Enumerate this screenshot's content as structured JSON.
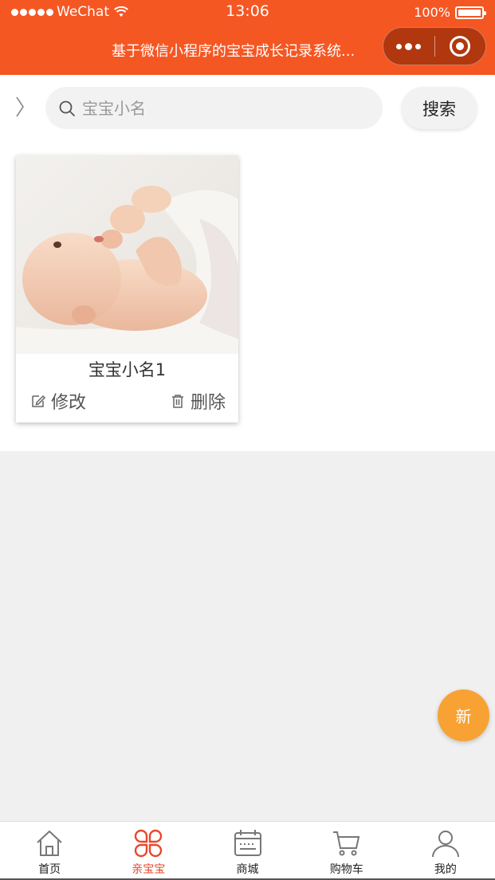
{
  "status_bar": {
    "carrier": "WeChat",
    "time": "13:06",
    "battery": "100%"
  },
  "nav": {
    "title": "基于微信小程序的宝宝成长记录系统..."
  },
  "search": {
    "placeholder": "宝宝小名",
    "button_label": "搜索"
  },
  "baby_cards": [
    {
      "name": "宝宝小名1",
      "edit_label": "修改",
      "delete_label": "删除"
    }
  ],
  "fab": {
    "label": "新"
  },
  "tabbar": {
    "items": [
      {
        "label": "首页",
        "icon": "home-icon",
        "active": false
      },
      {
        "label": "亲宝宝",
        "icon": "clover-icon",
        "active": true
      },
      {
        "label": "商城",
        "icon": "calendar-store-icon",
        "active": false
      },
      {
        "label": "购物车",
        "icon": "cart-icon",
        "active": false
      },
      {
        "label": "我的",
        "icon": "user-icon",
        "active": false
      }
    ]
  },
  "colors": {
    "brand": "#f55723",
    "fab": "#f8a233",
    "active_tab": "#e8472a"
  }
}
